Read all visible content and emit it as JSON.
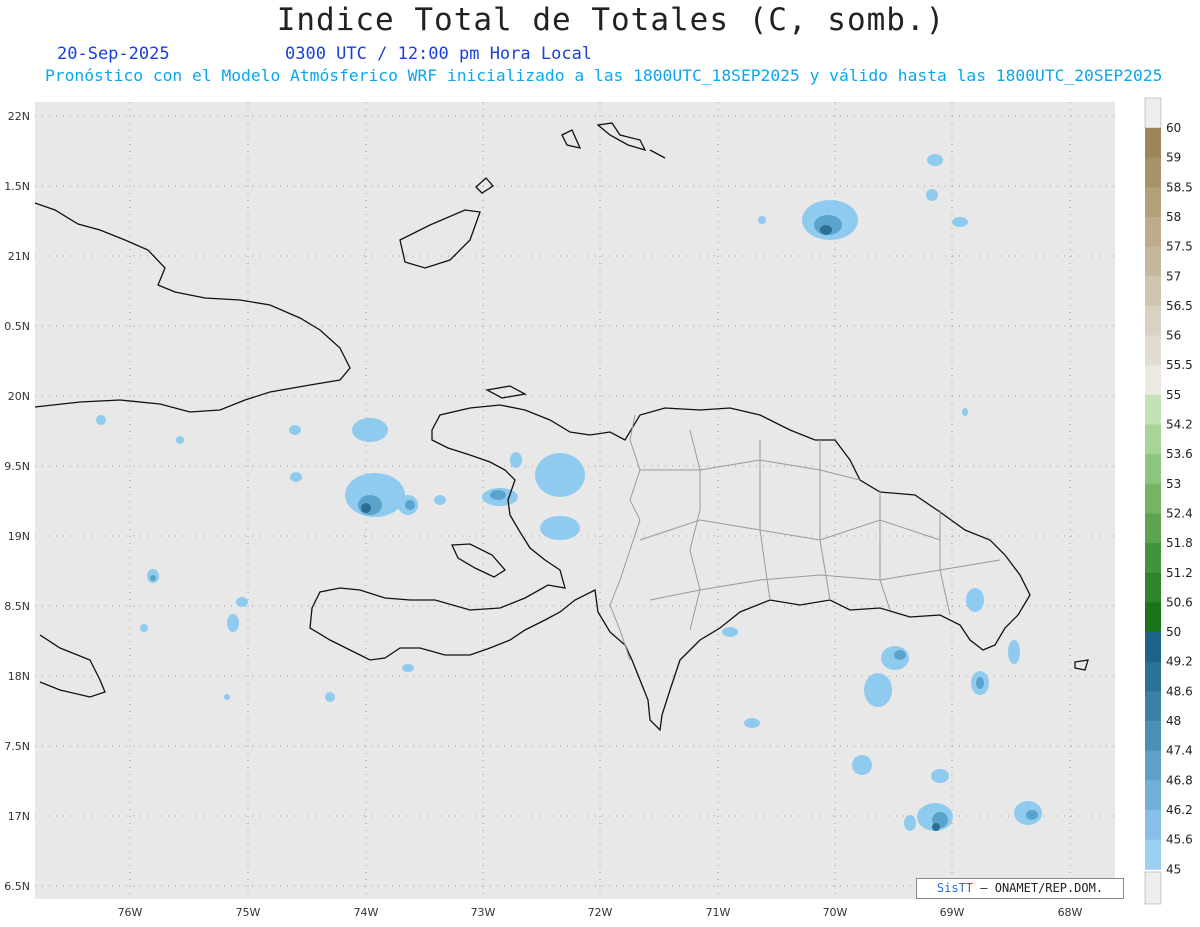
{
  "title": "Indice Total de Totales (C, somb.)",
  "date": "20-Sep-2025",
  "time": "0300 UTC / 12:00 pm Hora Local",
  "subtitle": "Pronóstico con el Modelo Atmósferico WRF inicializado a las 1800UTC_18SEP2025 y válido hasta las  1800UTC_20SEP2025",
  "lat_labels": [
    "22N",
    "1.5N",
    "21N",
    "0.5N",
    "20N",
    "9.5N",
    "19N",
    "8.5N",
    "18N",
    "7.5N",
    "17N",
    "6.5N"
  ],
  "lon_labels": [
    "76W",
    "75W",
    "74W",
    "73W",
    "72W",
    "71W",
    "70W",
    "69W",
    "68W"
  ],
  "colorbar": {
    "levels": [
      "60",
      "59",
      "58.5",
      "58",
      "57.5",
      "57",
      "56.5",
      "56",
      "55.5",
      "55",
      "54.2",
      "53.6",
      "53",
      "52.4",
      "51.8",
      "51.2",
      "50.6",
      "50",
      "49.2",
      "48.6",
      "48",
      "47.4",
      "46.8",
      "46.2",
      "45.6",
      "45"
    ],
    "colors": [
      "#9b8559",
      "#a8926a",
      "#b29f7c",
      "#bcab8d",
      "#c6b89f",
      "#cfc5b0",
      "#d9d1c2",
      "#e2ddd3",
      "#ece8e2",
      "#c3e2b5",
      "#a9d399",
      "#8fc47e",
      "#76b464",
      "#5da44d",
      "#43933a",
      "#2e8429",
      "#1c7419",
      "#1d6289",
      "#2a7196",
      "#3b80a5",
      "#4c8fb6",
      "#5ea0c8",
      "#72b0d8",
      "#86c0e6",
      "#9bd0f2"
    ],
    "top_color": "#eeeeee",
    "bottom_color": "#eeeeee"
  },
  "credit": {
    "logo": "SisTT",
    "text": "– ONAMET/REP.DOM."
  },
  "colors": {
    "map_bg": "#e8e8e8",
    "coast": "#111111",
    "border": "#9a9a9a",
    "field_light": "#8ecbee",
    "field_mid": "#5aa3cc",
    "field_dark": "#2a6f95"
  }
}
